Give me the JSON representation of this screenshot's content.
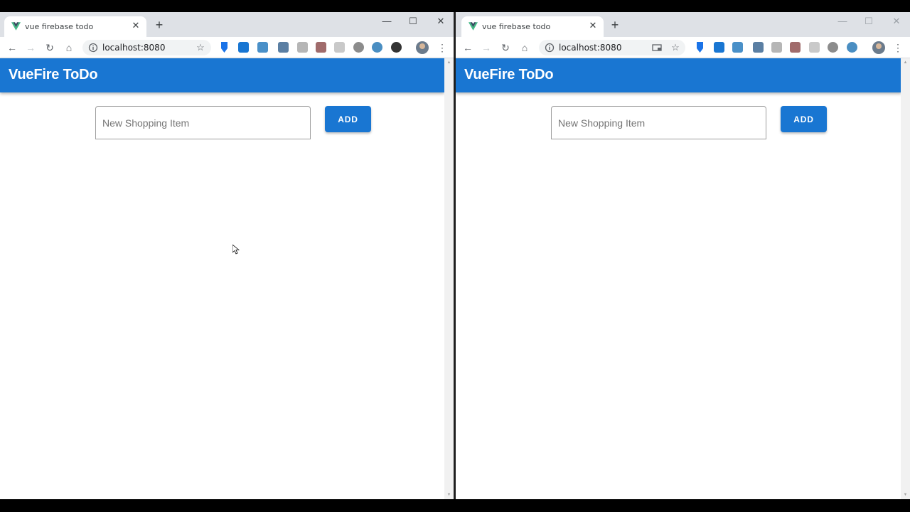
{
  "windows": [
    {
      "tab": {
        "title": "vue firebase todo"
      },
      "url": "localhost:8080",
      "app": {
        "title": "VueFire ToDo",
        "input_placeholder": "New Shopping Item",
        "input_value": "",
        "add_label": "ADD"
      }
    },
    {
      "tab": {
        "title": "vue firebase todo"
      },
      "url": "localhost:8080",
      "app": {
        "title": "VueFire ToDo",
        "input_placeholder": "New Shopping Item",
        "input_value": "",
        "add_label": "ADD"
      }
    }
  ],
  "icons": {
    "new_tab": "+",
    "close": "✕",
    "back": "←",
    "forward": "→",
    "reload": "↻",
    "home": "⌂",
    "star": "☆",
    "menu": "⋮",
    "minimize": "—",
    "maximize": "☐",
    "window_close": "✕"
  },
  "colors": {
    "app_bar": "#1976d2",
    "add_button": "#1976d2",
    "tab_strip": "#dee1e6"
  }
}
